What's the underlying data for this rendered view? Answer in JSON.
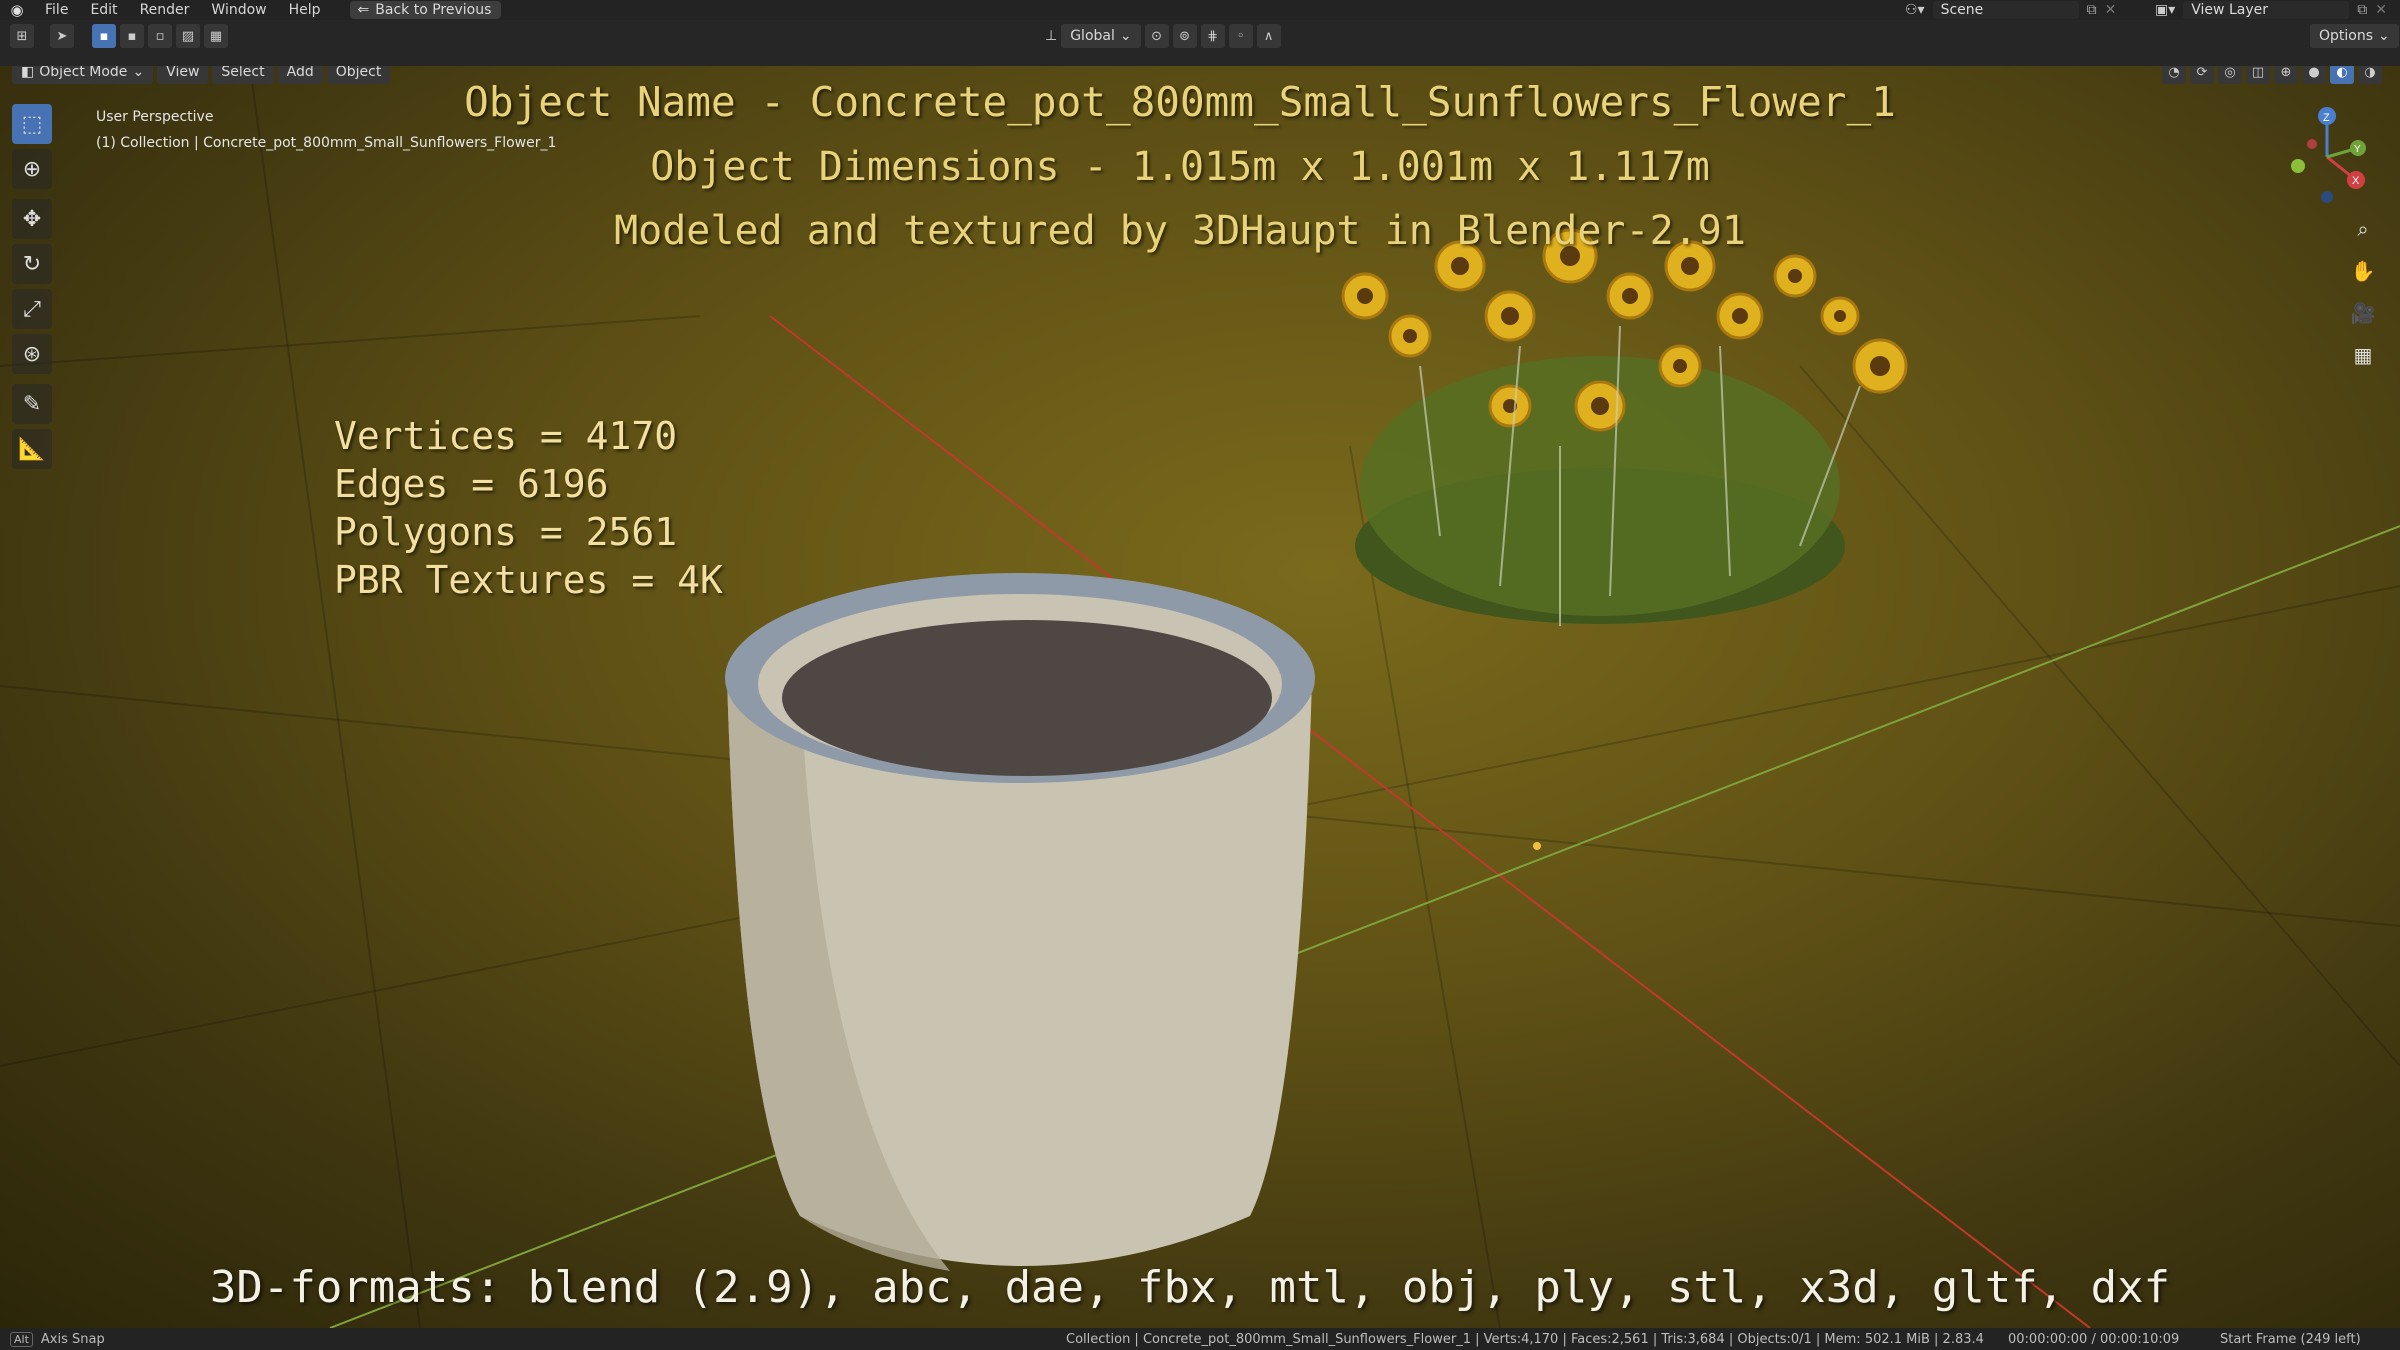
{
  "topbar": {
    "menu": [
      "File",
      "Edit",
      "Render",
      "Window",
      "Help"
    ],
    "back_button": "Back to Previous",
    "scene_label": "Scene",
    "view_layer_label": "View Layer"
  },
  "header": {
    "mode": "Object Mode",
    "menus": [
      "View",
      "Select",
      "Add",
      "Object"
    ],
    "transform_orientation": "Global",
    "options": "Options"
  },
  "viewport": {
    "perspective": "User Perspective",
    "collection": "(1) Collection | Concrete_pot_800mm_Small_Sunflowers_Flower_1"
  },
  "overlay": {
    "name_line": "Object Name - Concrete_pot_800mm_Small_Sunflowers_Flower_1",
    "dims_line": "Object Dimensions -  1.015m x 1.001m x 1.117m",
    "credit_line": "Modeled and textured by 3DHaupt in Blender-2.91",
    "stats": [
      "Vertices = 4170",
      "Edges = 6196",
      "Polygons = 2561",
      "PBR Textures = 4K"
    ],
    "formats": "3D-formats: blend (2.9), abc, dae, fbx, mtl, obj, ply, stl, x3d, gltf, dxf"
  },
  "gizmo": {
    "axes": [
      "Z",
      "Y",
      "X"
    ]
  },
  "statusbar": {
    "left_key": "Alt",
    "left_text": "Axis Snap",
    "stats": "Collection | Concrete_pot_800mm_Small_Sunflowers_Flower_1 | Verts:4,170 | Faces:2,561 | Tris:3,684 | Objects:0/1 | Mem: 502.1 MiB | 2.83.4",
    "time": "00:00:00:00 / 00:00:10:09",
    "frame": "Start Frame (249 left)"
  },
  "colors": {
    "accent": "#4772b3",
    "overlay_text": "#e8d27a",
    "x_axis": "#c0392b",
    "y_axis": "#7fa33a"
  }
}
